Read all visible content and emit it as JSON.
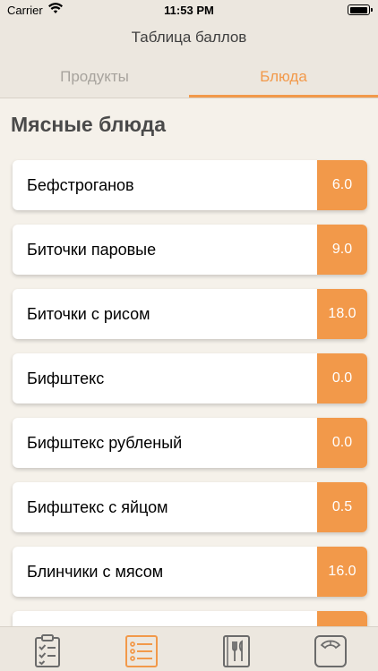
{
  "status": {
    "carrier": "Carrier",
    "time": "11:53 PM"
  },
  "nav": {
    "title": "Таблица баллов"
  },
  "tabs": [
    {
      "label": "Продукты",
      "active": false
    },
    {
      "label": "Блюда",
      "active": true
    }
  ],
  "section": {
    "title": "Мясные блюда"
  },
  "items": [
    {
      "name": "Бефстроганов",
      "score": "6.0"
    },
    {
      "name": "Биточки паровые",
      "score": "9.0"
    },
    {
      "name": "Биточки с рисом",
      "score": "18.0"
    },
    {
      "name": "Бифштекс",
      "score": "0.0"
    },
    {
      "name": "Бифштекс рубленый",
      "score": "0.0"
    },
    {
      "name": "Бифштекс с яйцом",
      "score": "0.5"
    },
    {
      "name": "Блинчики с мясом",
      "score": "16.0"
    }
  ],
  "tab_bar": [
    {
      "icon": "clipboard-checklist-icon",
      "active": false
    },
    {
      "icon": "list-icon",
      "active": true
    },
    {
      "icon": "menu-cutlery-icon",
      "active": false
    },
    {
      "icon": "scale-icon",
      "active": false
    }
  ],
  "colors": {
    "accent": "#f2994a",
    "inactive_icon": "#6b6b6b",
    "background": "#f5f1ea",
    "bar": "#ece7df"
  }
}
